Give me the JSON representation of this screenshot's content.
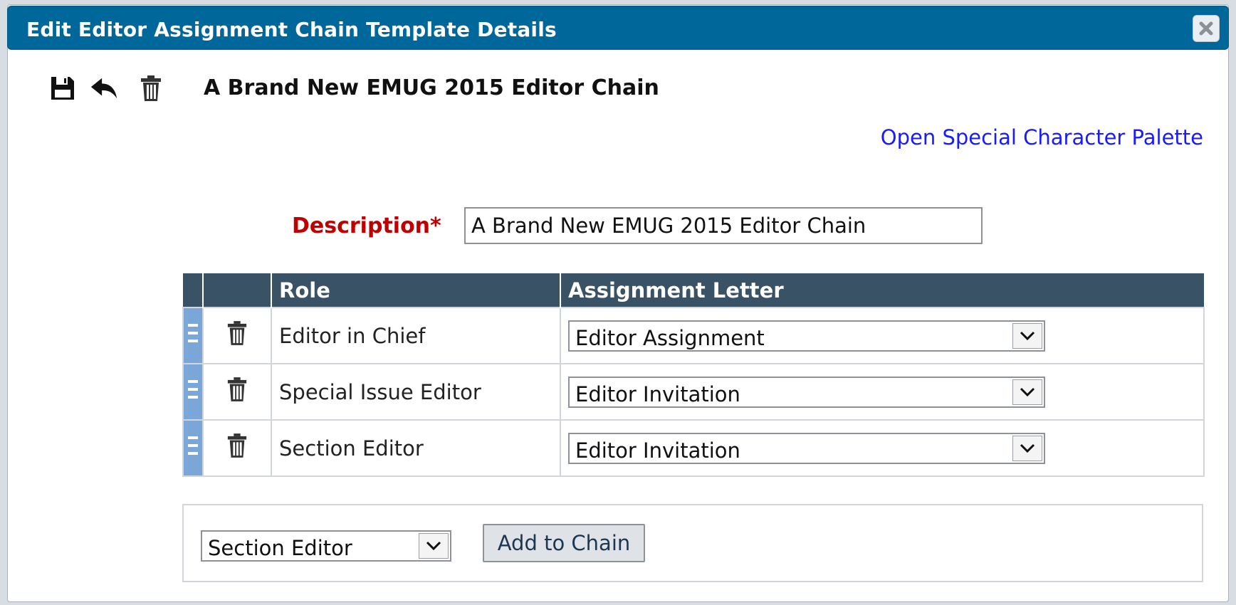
{
  "dialog": {
    "title": "Edit Editor Assignment Chain Template Details",
    "close_icon": "close-icon"
  },
  "toolbar": {
    "save_icon": "save-icon",
    "undo_icon": "undo-icon",
    "delete_icon": "trash-icon"
  },
  "chain_title": "A Brand New EMUG 2015 Editor Chain",
  "palette_link": "Open Special Character Palette",
  "form": {
    "description_label": "Description*",
    "description_value": "A Brand New EMUG 2015 Editor Chain"
  },
  "table": {
    "headers": [
      "",
      "",
      "Role",
      "Assignment Letter"
    ],
    "rows": [
      {
        "role": "Editor in Chief",
        "letter": "Editor Assignment"
      },
      {
        "role": "Special Issue Editor",
        "letter": "Editor Invitation"
      },
      {
        "role": "Section Editor",
        "letter": "Editor Invitation"
      }
    ]
  },
  "add_panel": {
    "role_select": "Section Editor",
    "add_button": "Add to Chain"
  },
  "colors": {
    "title_bar": "#00679a",
    "table_header": "#3a5266",
    "drag_handle": "#7aa7d8",
    "required_label": "#c00000",
    "link": "#1a1aff"
  }
}
